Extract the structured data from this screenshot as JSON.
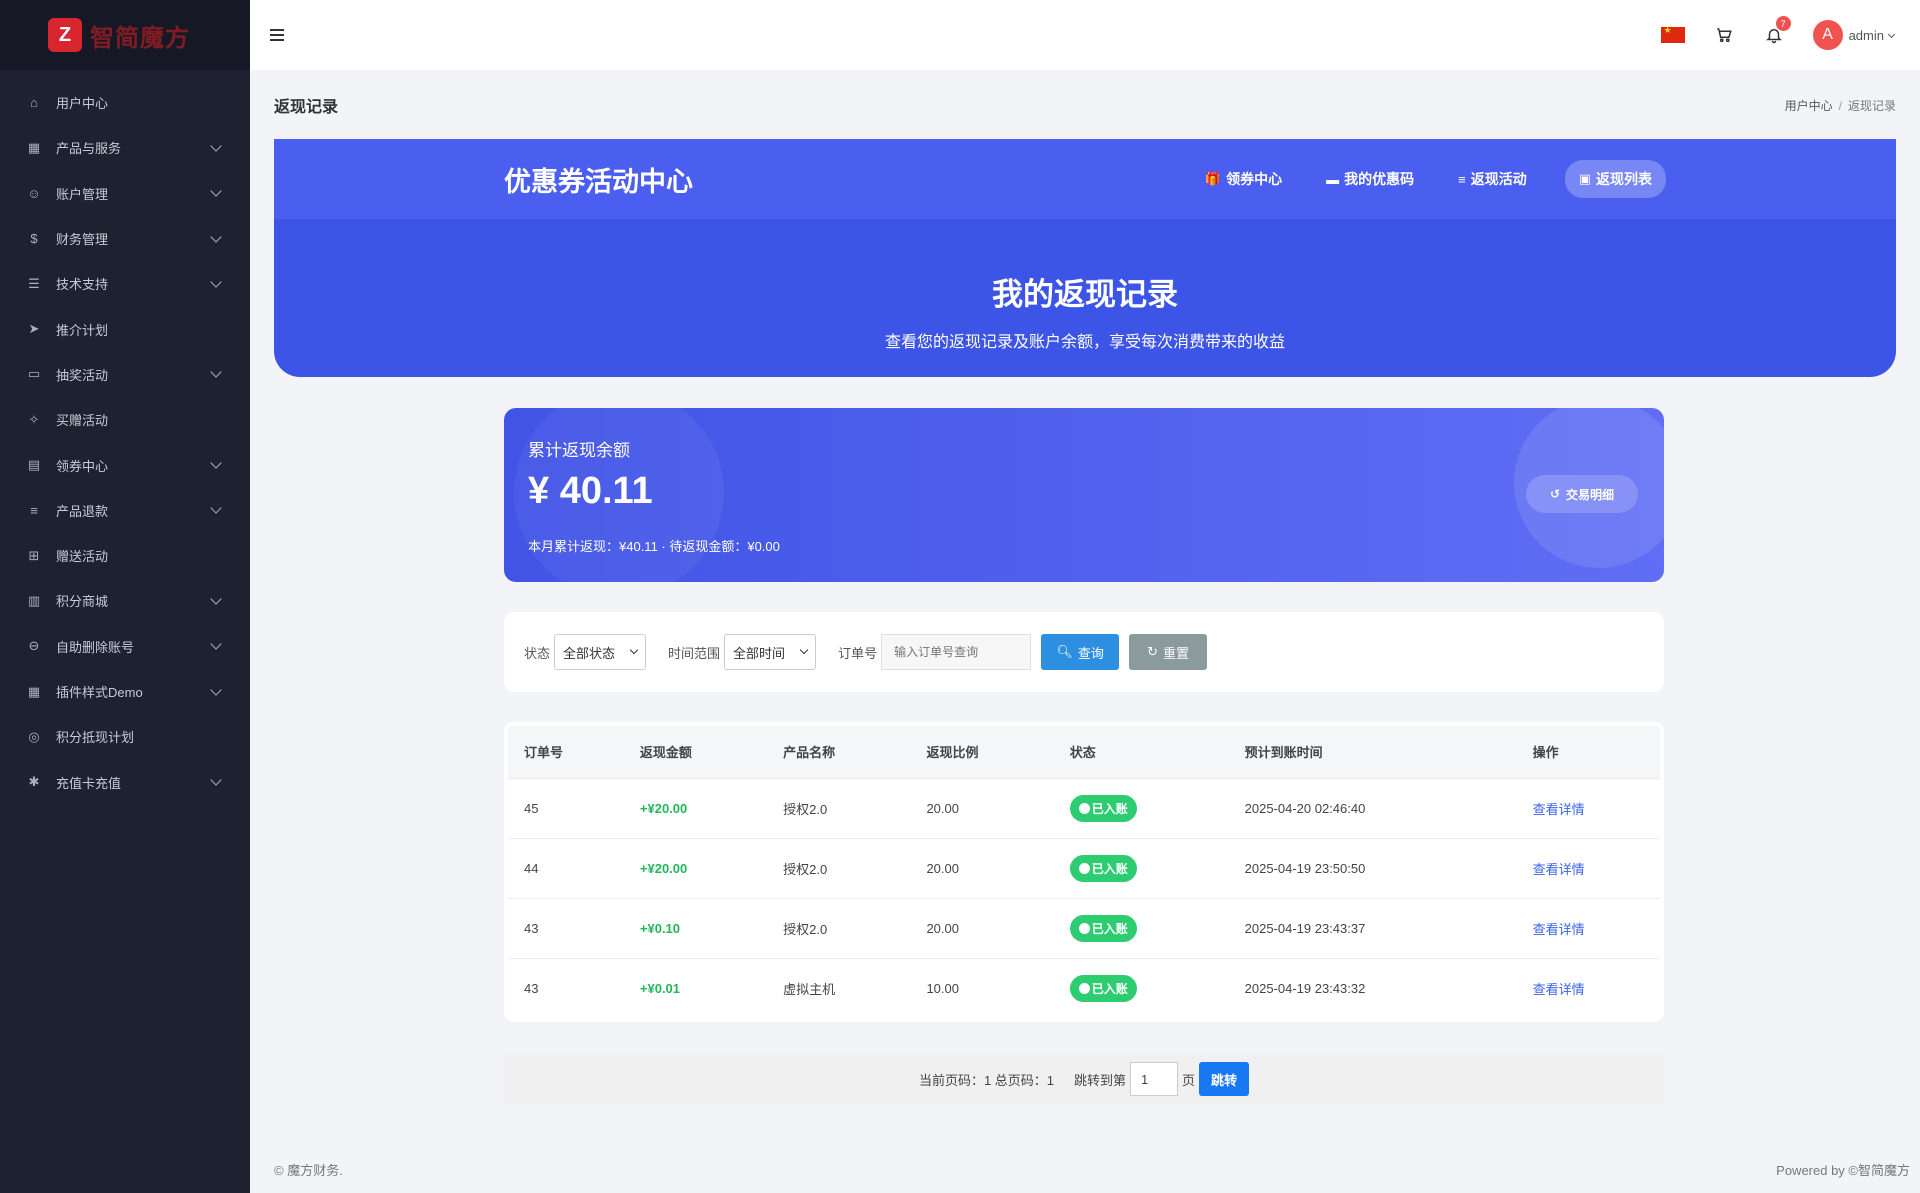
{
  "sidebar": {
    "logo_text": "智简魔方",
    "items": [
      {
        "label": "用户中心",
        "icon": "home-icon",
        "chevron": false
      },
      {
        "label": "产品与服务",
        "icon": "grid-icon",
        "chevron": true
      },
      {
        "label": "账户管理",
        "icon": "user-icon",
        "chevron": true
      },
      {
        "label": "财务管理",
        "icon": "dollar-icon",
        "chevron": true
      },
      {
        "label": "技术支持",
        "icon": "document-icon",
        "chevron": true
      },
      {
        "label": "推介计划",
        "icon": "send-icon",
        "chevron": false
      },
      {
        "label": "抽奖活动",
        "icon": "briefcase-icon",
        "chevron": true
      },
      {
        "label": "买赠活动",
        "icon": "sparkle-icon",
        "chevron": false
      },
      {
        "label": "领券中心",
        "icon": "calendar-icon",
        "chevron": true
      },
      {
        "label": "产品退款",
        "icon": "sliders-icon",
        "chevron": true
      },
      {
        "label": "赠送活动",
        "icon": "plus-box-icon",
        "chevron": false
      },
      {
        "label": "积分商城",
        "icon": "store-icon",
        "chevron": true
      },
      {
        "label": "自助删除账号",
        "icon": "minus-circle-icon",
        "chevron": true
      },
      {
        "label": "插件样式Demo",
        "icon": "grid-icon",
        "chevron": true
      },
      {
        "label": "积分抵现计划",
        "icon": "target-icon",
        "chevron": false
      },
      {
        "label": "充值卡充值",
        "icon": "asterisk-icon",
        "chevron": true
      }
    ]
  },
  "topbar": {
    "notification_count": "7",
    "avatar_letter": "A",
    "username": "admin"
  },
  "page": {
    "title": "返现记录",
    "breadcrumb": [
      "用户中心",
      "返现记录"
    ]
  },
  "hero": {
    "brand": "优惠券活动中心",
    "links": [
      "领券中心",
      "我的优惠码",
      "返现活动",
      "返现列表"
    ],
    "title": "我的返现记录",
    "subtitle": "查看您的返现记录及账户余额，享受每次消费带来的收益"
  },
  "balance": {
    "label": "累计返现余额",
    "amount": "¥ 40.11",
    "note": "本月累计返现：¥40.11 · 待返现金额：¥0.00",
    "tx_button": "交易明细"
  },
  "filter": {
    "status_label": "状态",
    "status_value": "全部状态",
    "time_label": "时间范围",
    "time_value": "全部时间",
    "order_label": "订单号",
    "order_placeholder": "输入订单号查询",
    "query_button": "查询",
    "reset_button": "重置"
  },
  "table": {
    "headers": [
      "订单号",
      "返现金额",
      "产品名称",
      "返现比例",
      "状态",
      "预计到账时间",
      "操作"
    ],
    "rows": [
      {
        "order": "45",
        "amount": "+¥20.00",
        "product": "授权2.0",
        "ratio": "20.00",
        "status": "已入账",
        "time": "2025-04-20 02:46:40",
        "action": "查看详情"
      },
      {
        "order": "44",
        "amount": "+¥20.00",
        "product": "授权2.0",
        "ratio": "20.00",
        "status": "已入账",
        "time": "2025-04-19 23:50:50",
        "action": "查看详情"
      },
      {
        "order": "43",
        "amount": "+¥0.10",
        "product": "授权2.0",
        "ratio": "20.00",
        "status": "已入账",
        "time": "2025-04-19 23:43:37",
        "action": "查看详情"
      },
      {
        "order": "43",
        "amount": "+¥0.01",
        "product": "虚拟主机",
        "ratio": "10.00",
        "status": "已入账",
        "time": "2025-04-19 23:43:32",
        "action": "查看详情"
      }
    ]
  },
  "pager": {
    "info": "当前页码：1 总页码：1",
    "jump_prefix": "跳转到第",
    "page_value": "1",
    "jump_suffix": "页",
    "jump_button": "跳转"
  },
  "footer": {
    "left": "© 魔方财务.",
    "right": "Powered by ©智简魔方"
  }
}
